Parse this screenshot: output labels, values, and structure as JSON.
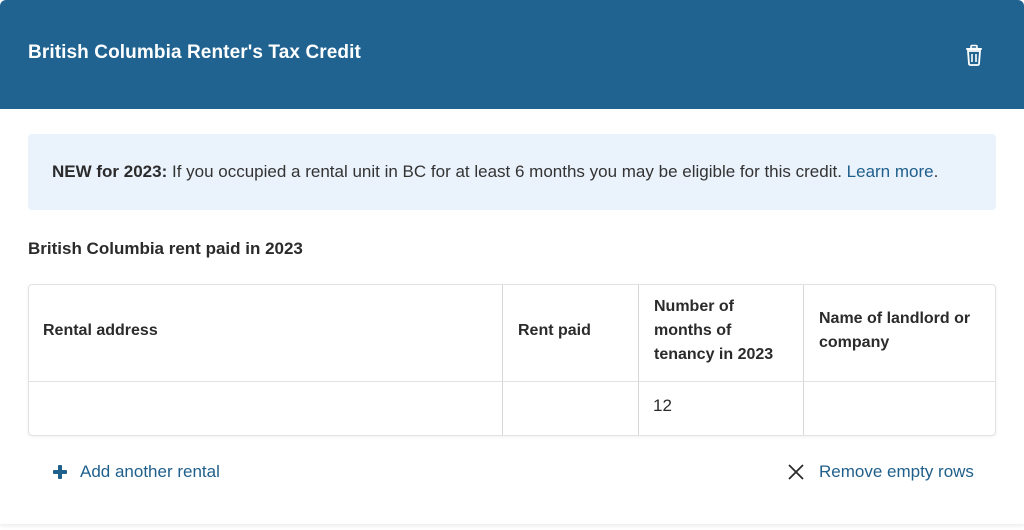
{
  "header": {
    "title": "British Columbia Renter's Tax Credit"
  },
  "notice": {
    "label": "NEW for 2023:",
    "text": " If you occupied a rental unit in BC for at least 6 months you may be eligible for this credit. ",
    "link": "Learn more",
    "suffix": "."
  },
  "section": {
    "title": "British Columbia rent paid in 2023"
  },
  "table": {
    "headers": {
      "rental_address": "Rental address",
      "rent_paid": "Rent paid",
      "months_line1": "Number of",
      "months_line2": "months of",
      "months_line3": "tenancy in 2023",
      "landlord_line1": "Name of landlord or",
      "landlord_line2": "company"
    },
    "rows": [
      {
        "rental_address": "",
        "rent_paid": "",
        "months": "12",
        "landlord": ""
      }
    ]
  },
  "actions": {
    "add_label": "Add another rental",
    "remove_label": "Remove empty rows"
  },
  "colors": {
    "header_bg": "#206390",
    "notice_bg": "#eaf2fc",
    "link": "#1f5f8b"
  }
}
